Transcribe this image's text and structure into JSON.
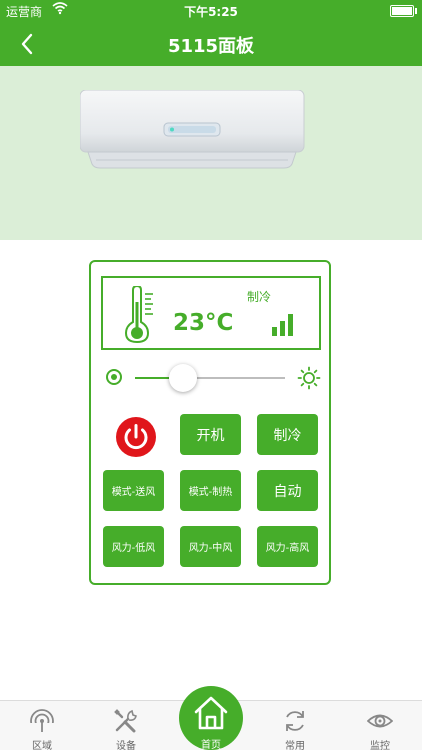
{
  "status_bar": {
    "carrier": "运营商",
    "time": "下午5:25"
  },
  "nav": {
    "title": "5115面板",
    "back_icon": "chevron-left-icon"
  },
  "display": {
    "temperature": "23°C",
    "mode": "制冷",
    "thermometer_icon": "thermometer-icon",
    "signal_icon": "signal-bars-icon"
  },
  "slider": {
    "level": 0.32,
    "min_icon": "dot-circle-icon",
    "max_icon": "sun-icon"
  },
  "controls": {
    "power_icon": "power-icon",
    "buttons": [
      {
        "label": "开机"
      },
      {
        "label": "制冷"
      },
      {
        "label": "模式-送风"
      },
      {
        "label": "模式-制热"
      },
      {
        "label": "自动"
      },
      {
        "label": "风力-低风"
      },
      {
        "label": "风力-中风"
      },
      {
        "label": "风力-高风"
      }
    ]
  },
  "tabs": [
    {
      "label": "区域",
      "icon": "signal-area-icon"
    },
    {
      "label": "设备",
      "icon": "tools-icon"
    },
    {
      "label": "首页",
      "icon": "home-icon",
      "active": true
    },
    {
      "label": "常用",
      "icon": "refresh-icon"
    },
    {
      "label": "监控",
      "icon": "eye-icon"
    }
  ],
  "colors": {
    "primary": "#46ad2a",
    "hero_bg": "#dbeed7",
    "power_red": "#e0161b"
  }
}
